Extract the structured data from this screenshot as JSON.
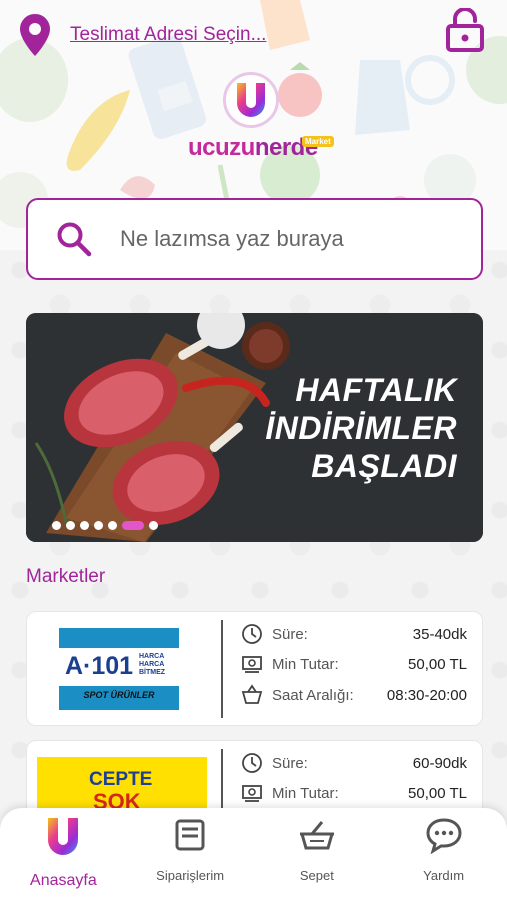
{
  "header": {
    "address_link": "Teslimat Adresi Seçin...",
    "location_icon": "map-pin-icon",
    "lock_icon": "lock-icon"
  },
  "logo": {
    "letter": "U",
    "text_part1": "ucuzu",
    "text_part2": "nerde",
    "badge": "Market"
  },
  "search": {
    "placeholder": "Ne lazımsa yaz buraya",
    "icon": "search-icon"
  },
  "banner": {
    "lines": [
      "HAFTALIK",
      "İNDİRİMLER",
      "BAŞLADI"
    ],
    "dot_count": 6,
    "active_dot": 5
  },
  "markets": {
    "title": "Marketler",
    "items": [
      {
        "logo_main": "A·101",
        "logo_side": [
          "HARCA",
          "HARCA",
          "BİTMEZ"
        ],
        "logo_sub": "SPOT ÜRÜNLER",
        "sure_label": "Süre:",
        "sure_value": "35-40dk",
        "min_label": "Min Tutar:",
        "min_value": "50,00 TL",
        "saat_label": "Saat Aralığı:",
        "saat_value": "08:30-20:00"
      },
      {
        "logo_main": "CEPTE",
        "logo_sub": "ŞOK",
        "sure_label": "Süre:",
        "sure_value": "60-90dk",
        "min_label": "Min Tutar:",
        "min_value": "50,00 TL"
      }
    ]
  },
  "tabbar": {
    "tabs": [
      {
        "label": "Anasayfa",
        "icon": "home-u-icon",
        "active": true
      },
      {
        "label": "Siparişlerim",
        "icon": "orders-icon",
        "active": false
      },
      {
        "label": "Sepet",
        "icon": "basket-icon",
        "active": false
      },
      {
        "label": "Yardım",
        "icon": "chat-help-icon",
        "active": false
      }
    ]
  },
  "colors": {
    "accent": "#a2249b",
    "active_dot": "#e256c9",
    "a101_blue": "#1b8fc4",
    "sok_yellow": "#ffe000"
  }
}
